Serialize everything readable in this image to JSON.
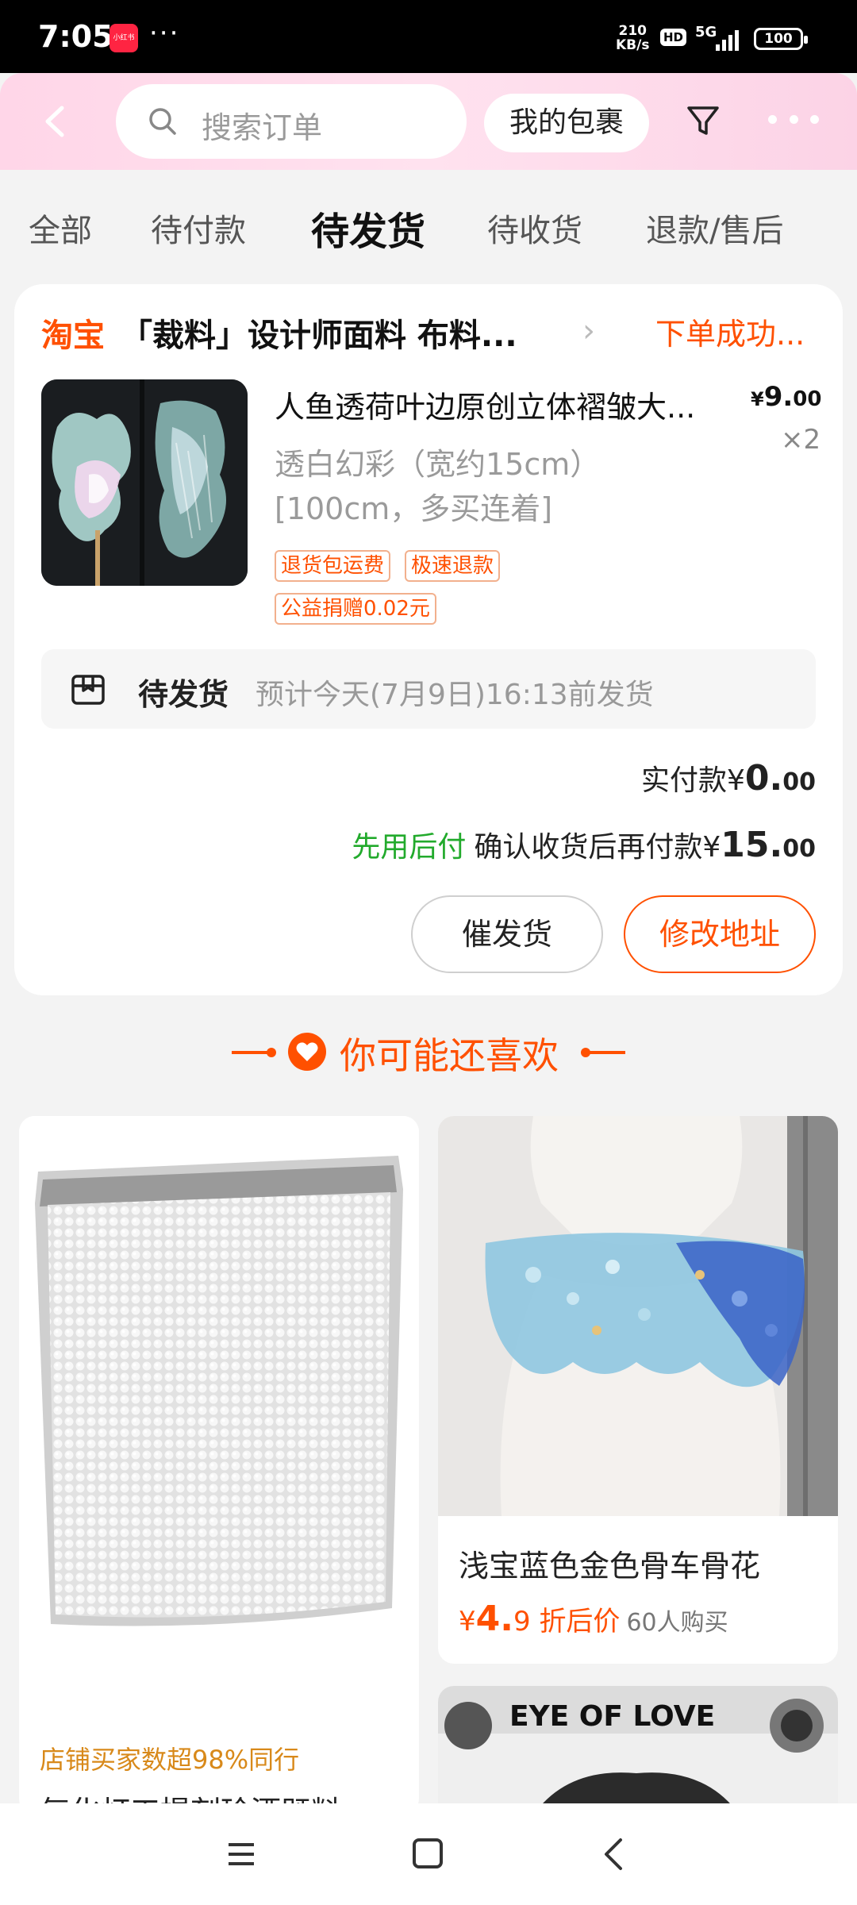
{
  "status_bar": {
    "time": "7:05",
    "app_badge": "小红书",
    "more": "···",
    "net_speed_top": "210",
    "net_speed_bottom": "KB/s",
    "hd": "HD",
    "network": "5G",
    "battery": "100"
  },
  "header": {
    "search_placeholder": "搜索订单",
    "parcel_label": "我的包裹",
    "icons": [
      "back-icon",
      "search-icon",
      "filter-icon",
      "more-icon"
    ]
  },
  "tabs": [
    {
      "label": "全部",
      "active": false
    },
    {
      "label": "待付款",
      "active": false
    },
    {
      "label": "待发货",
      "active": true
    },
    {
      "label": "待收货",
      "active": false
    },
    {
      "label": "退款/售后",
      "active": false
    }
  ],
  "order": {
    "platform": "淘宝",
    "shop_name": "「裁料」设计师面料 布料...",
    "status": "下单成功...",
    "product": {
      "title": "人鱼透荷叶边原创立体褶皱大...",
      "price_currency": "¥",
      "price_int": "9.",
      "price_dec": "00",
      "quantity": "×2",
      "spec_line1": "透白幻彩（宽约15cm）",
      "spec_line2": "[100cm，多买连着]",
      "tags": [
        "退货包运费",
        "极速退款",
        "公益捐赠0.02元"
      ]
    },
    "shipping": {
      "status": "待发货",
      "eta": "预计今天(7月9日)16:13前发货"
    },
    "paid_label": "实付款",
    "paid_currency": "¥",
    "paid_int": "0.",
    "paid_dec": "00",
    "paylater_label": "先用后付",
    "paylater_text": "确认收货后再付款",
    "paylater_currency": "¥",
    "paylater_int": "15.",
    "paylater_dec": "00",
    "buttons": {
      "urge": "催发货",
      "change_address": "修改地址"
    }
  },
  "recommendations": {
    "title": "你可能还喜欢",
    "items": [
      {
        "note": "店铺买家数超98%同行",
        "title": "气化灯工提刻珍酒既料"
      },
      {
        "title": "浅宝蓝色金色骨车骨花",
        "price_currency": "¥",
        "price_int": "4.",
        "price_dec": "9",
        "price_label": "折后价",
        "sold": "60人购买"
      },
      {
        "banner": "EYE OF LOVE"
      }
    ]
  },
  "colors": {
    "accent": "#ff5000",
    "green": "#22aa2c",
    "header_pink": "#ffd6e8"
  }
}
